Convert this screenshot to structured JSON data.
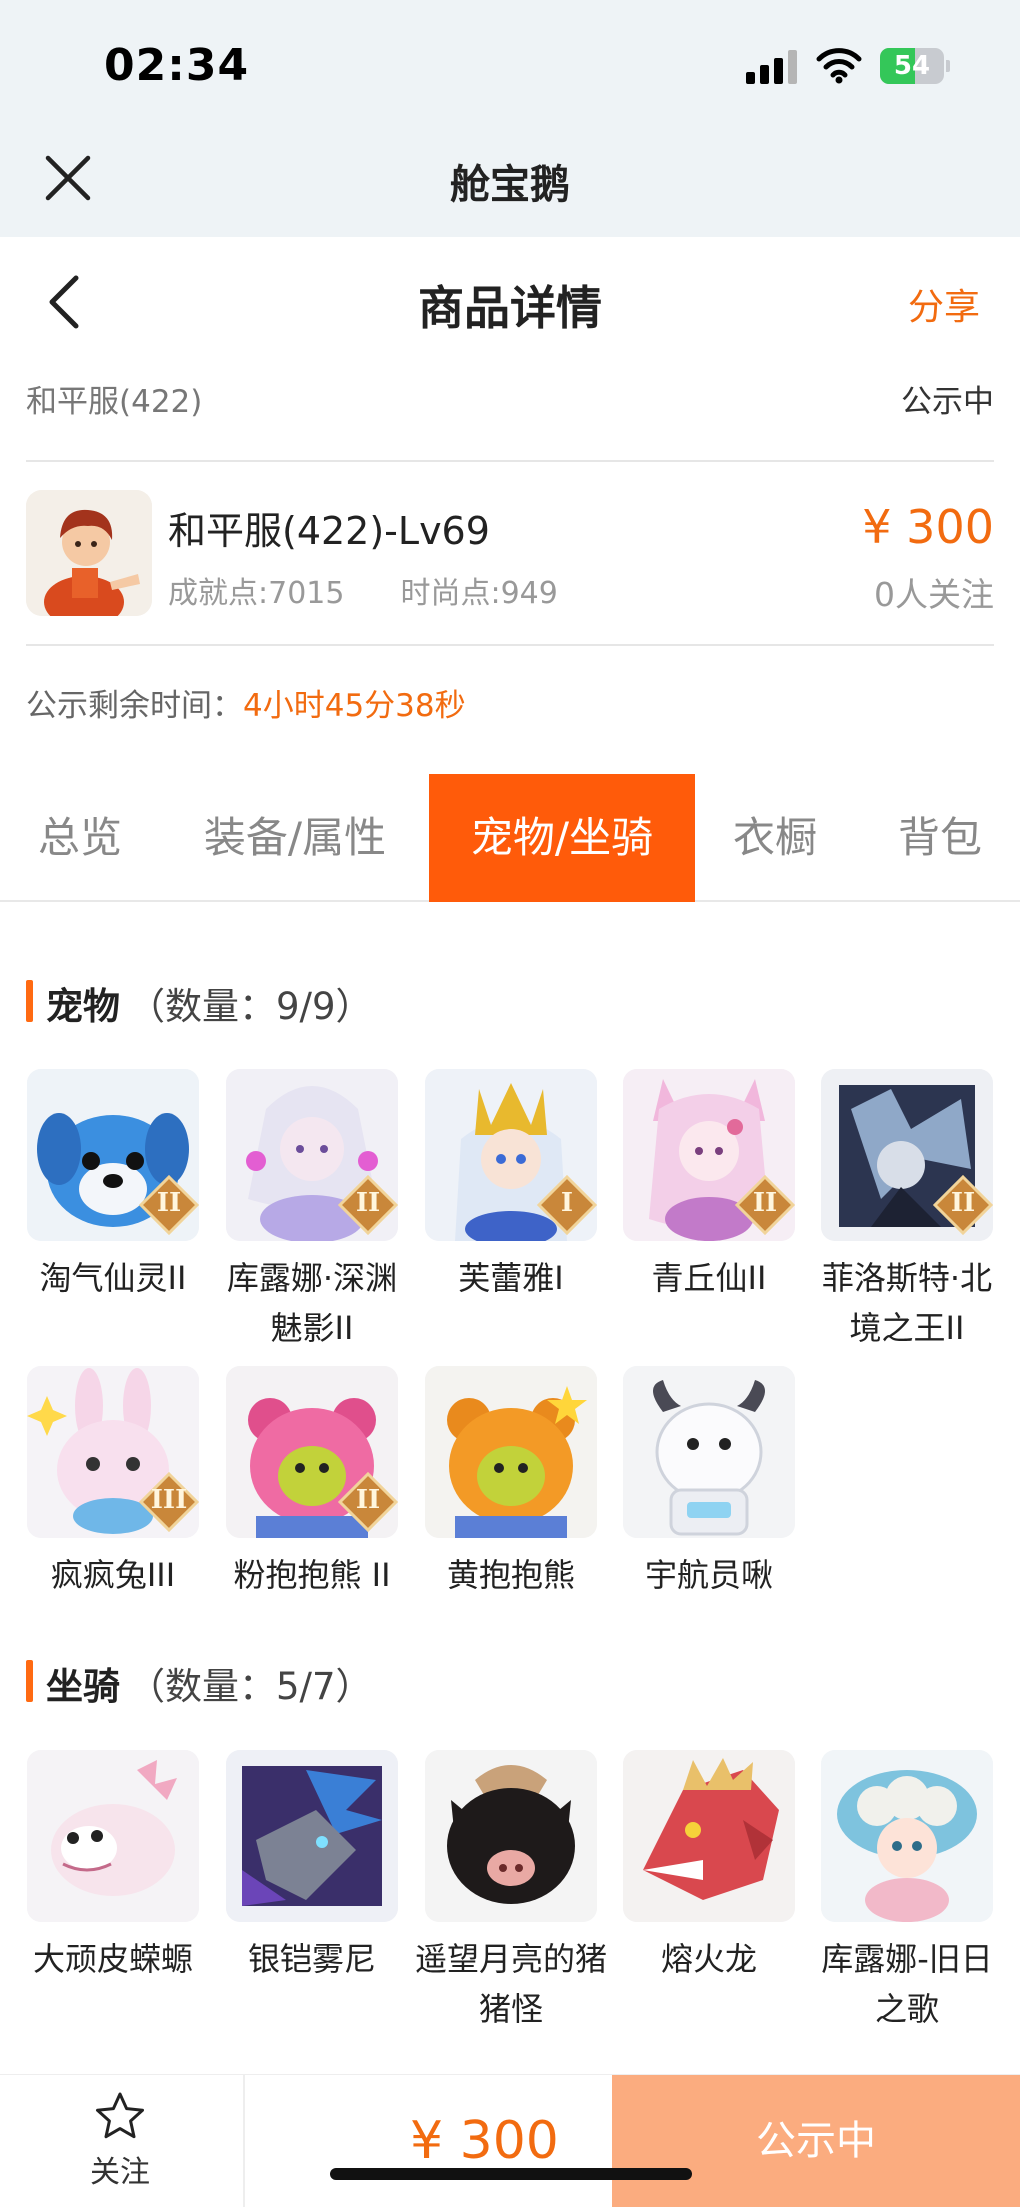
{
  "status_bar": {
    "time": "02:34",
    "battery": "54",
    "battery_level": 0.54
  },
  "app": {
    "title": "舱宝鹅"
  },
  "header": {
    "title": "商品详情",
    "share_label": "分享"
  },
  "server": {
    "name": "和平服(422)",
    "status": "公示中"
  },
  "product": {
    "name": "和平服(422)-Lv69",
    "achievement": "成就点:7015",
    "fashion": "时尚点:949",
    "price": "¥ 300",
    "followers": "0人关注"
  },
  "countdown": {
    "label": "公示剩余时间：",
    "value": "4小时45分38秒"
  },
  "tabs": [
    "总览",
    "装备/属性",
    "宠物/坐骑",
    "衣橱",
    "背包"
  ],
  "active_tab": 2,
  "pets": {
    "title": "宠物",
    "count": "（数量：9/9）",
    "items": [
      {
        "name": "淘气仙灵II",
        "badge": "II"
      },
      {
        "name": "库露娜·深渊魅影II",
        "badge": "II"
      },
      {
        "name": "芙蕾雅I",
        "badge": "I"
      },
      {
        "name": "青丘仙II",
        "badge": "II"
      },
      {
        "name": "菲洛斯特·北境之王II",
        "badge": "II"
      },
      {
        "name": "疯疯兔III",
        "badge": "III"
      },
      {
        "name": "粉抱抱熊 II",
        "badge": "II"
      },
      {
        "name": "黄抱抱熊",
        "badge": ""
      },
      {
        "name": "宇航员啾",
        "badge": ""
      }
    ]
  },
  "mounts": {
    "title": "坐骑",
    "count": "（数量：5/7）",
    "items": [
      {
        "name": "大顽皮蝾螈"
      },
      {
        "name": "银铠雾尼"
      },
      {
        "name": "遥望月亮的猪猪怪"
      },
      {
        "name": "熔火龙"
      },
      {
        "name": "库露娜-旧日之歌"
      }
    ]
  },
  "bottom_bar": {
    "follow_label": "关注",
    "price": "¥ 300",
    "action_label": "公示中"
  },
  "colors": {
    "accent": "#f26b10",
    "tab_active": "#ff5b0a",
    "cta": "#fbac7f",
    "top_bg": "#eef3f6"
  }
}
